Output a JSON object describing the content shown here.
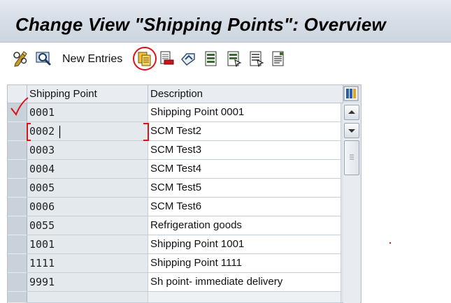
{
  "window": {
    "title": "Change View \"Shipping Points\": Overview"
  },
  "toolbar": {
    "new_entries_label": "New Entries",
    "icons": [
      "display-change-icon",
      "find-icon",
      "copy-as-icon",
      "delete-icon",
      "undo-change-icon",
      "select-all-icon",
      "select-block-icon",
      "deselect-all-icon",
      "print-field-list-icon"
    ]
  },
  "table": {
    "columns": [
      "Shipping Point",
      "Description"
    ],
    "rows": [
      {
        "code": "0001",
        "description": "Shipping Point 0001"
      },
      {
        "code": "0002",
        "description": "SCM Test2"
      },
      {
        "code": "0003",
        "description": "SCM Test3"
      },
      {
        "code": "0004",
        "description": "SCM Test4"
      },
      {
        "code": "0005",
        "description": "SCM Test5"
      },
      {
        "code": "0006",
        "description": "SCM Test6"
      },
      {
        "code": "0055",
        "description": "Refrigeration goods"
      },
      {
        "code": "1001",
        "description": "Shipping Point 1001"
      },
      {
        "code": "1111",
        "description": "Shipping Point 1111"
      },
      {
        "code": "9991",
        "description": "Sh point- immediate delivery"
      }
    ]
  },
  "colors": {
    "annotation_red": "#d8141a",
    "title_bar": "#d7dee7",
    "key_column": "#e4e9ee"
  }
}
